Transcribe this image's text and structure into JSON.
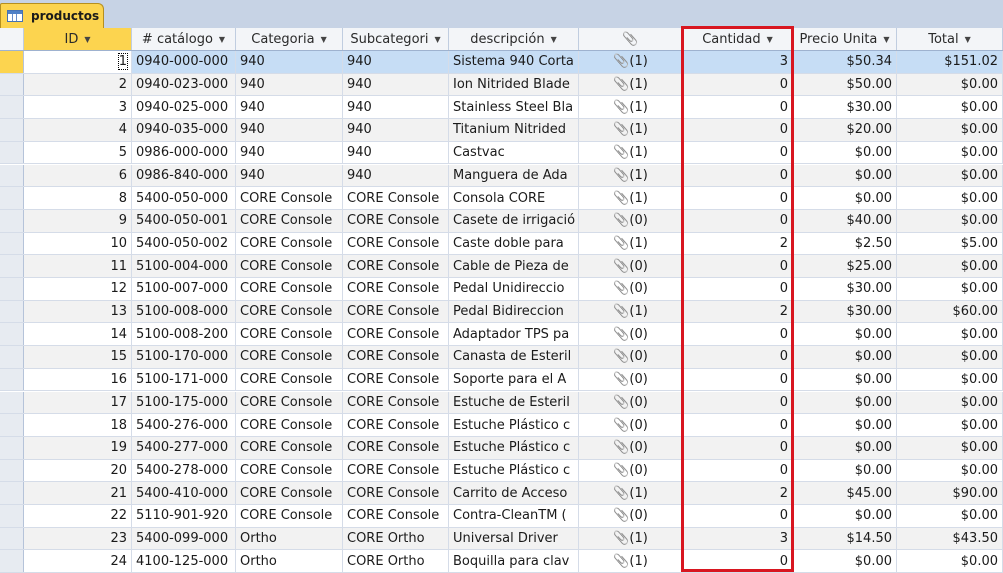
{
  "tab": {
    "label": "productos",
    "icon": "table-icon"
  },
  "columns": [
    {
      "label": "ID"
    },
    {
      "label": "# catálogo"
    },
    {
      "label": "Categoria"
    },
    {
      "label": "Subcategori"
    },
    {
      "label": "descripción"
    },
    {
      "label": "",
      "icon": "paperclip-icon"
    },
    {
      "label": "Cantidad"
    },
    {
      "label": "Precio Unita"
    },
    {
      "label": "Total"
    }
  ],
  "rows": [
    {
      "id": "1",
      "cat": "0940-000-000",
      "categoria": "940",
      "sub": "940",
      "desc": "Sistema 940 Corta",
      "att": "(1)",
      "cant": "3",
      "precio": "$50.34",
      "total": "$151.02"
    },
    {
      "id": "2",
      "cat": "0940-023-000",
      "categoria": "940",
      "sub": "940",
      "desc": "Ion Nitrided Blade",
      "att": "(1)",
      "cant": "0",
      "precio": "$50.00",
      "total": "$0.00"
    },
    {
      "id": "3",
      "cat": "0940-025-000",
      "categoria": "940",
      "sub": "940",
      "desc": "Stainless Steel Bla",
      "att": "(1)",
      "cant": "0",
      "precio": "$30.00",
      "total": "$0.00"
    },
    {
      "id": "4",
      "cat": "0940-035-000",
      "categoria": "940",
      "sub": "940",
      "desc": "Titanium Nitrided",
      "att": "(1)",
      "cant": "0",
      "precio": "$20.00",
      "total": "$0.00"
    },
    {
      "id": "5",
      "cat": "0986-000-000",
      "categoria": "940",
      "sub": "940",
      "desc": "Castvac",
      "att": "(1)",
      "cant": "0",
      "precio": "$0.00",
      "total": "$0.00"
    },
    {
      "id": "6",
      "cat": "0986-840-000",
      "categoria": "940",
      "sub": "940",
      "desc": "Manguera de Ada",
      "att": "(1)",
      "cant": "0",
      "precio": "$0.00",
      "total": "$0.00"
    },
    {
      "id": "8",
      "cat": "5400-050-000",
      "categoria": "CORE Console",
      "sub": "CORE Console",
      "desc": "Consola CORE",
      "att": "(1)",
      "cant": "0",
      "precio": "$0.00",
      "total": "$0.00"
    },
    {
      "id": "9",
      "cat": "5400-050-001",
      "categoria": "CORE Console",
      "sub": "CORE Console",
      "desc": "Casete de irrigació",
      "att": "(0)",
      "cant": "0",
      "precio": "$40.00",
      "total": "$0.00"
    },
    {
      "id": "10",
      "cat": "5400-050-002",
      "categoria": "CORE Console",
      "sub": "CORE Console",
      "desc": "Caste doble para",
      "att": "(1)",
      "cant": "2",
      "precio": "$2.50",
      "total": "$5.00"
    },
    {
      "id": "11",
      "cat": "5100-004-000",
      "categoria": "CORE Console",
      "sub": "CORE Console",
      "desc": "Cable de Pieza de",
      "att": "(0)",
      "cant": "0",
      "precio": "$25.00",
      "total": "$0.00"
    },
    {
      "id": "12",
      "cat": "5100-007-000",
      "categoria": "CORE Console",
      "sub": "CORE Console",
      "desc": "Pedal Unidireccio",
      "att": "(0)",
      "cant": "0",
      "precio": "$30.00",
      "total": "$0.00"
    },
    {
      "id": "13",
      "cat": "5100-008-000",
      "categoria": "CORE Console",
      "sub": "CORE Console",
      "desc": "Pedal Bidireccion",
      "att": "(1)",
      "cant": "2",
      "precio": "$30.00",
      "total": "$60.00"
    },
    {
      "id": "14",
      "cat": "5100-008-200",
      "categoria": "CORE Console",
      "sub": "CORE Console",
      "desc": "Adaptador TPS pa",
      "att": "(0)",
      "cant": "0",
      "precio": "$0.00",
      "total": "$0.00"
    },
    {
      "id": "15",
      "cat": "5100-170-000",
      "categoria": "CORE Console",
      "sub": "CORE Console",
      "desc": "Canasta de Esteril",
      "att": "(0)",
      "cant": "0",
      "precio": "$0.00",
      "total": "$0.00"
    },
    {
      "id": "16",
      "cat": "5100-171-000",
      "categoria": "CORE Console",
      "sub": "CORE Console",
      "desc": "Soporte para el A",
      "att": "(0)",
      "cant": "0",
      "precio": "$0.00",
      "total": "$0.00"
    },
    {
      "id": "17",
      "cat": "5100-175-000",
      "categoria": "CORE Console",
      "sub": "CORE Console",
      "desc": "Estuche de Esteril",
      "att": "(0)",
      "cant": "0",
      "precio": "$0.00",
      "total": "$0.00"
    },
    {
      "id": "18",
      "cat": "5400-276-000",
      "categoria": "CORE Console",
      "sub": "CORE Console",
      "desc": "Estuche Plástico c",
      "att": "(0)",
      "cant": "0",
      "precio": "$0.00",
      "total": "$0.00"
    },
    {
      "id": "19",
      "cat": "5400-277-000",
      "categoria": "CORE Console",
      "sub": "CORE Console",
      "desc": "Estuche Plástico c",
      "att": "(0)",
      "cant": "0",
      "precio": "$0.00",
      "total": "$0.00"
    },
    {
      "id": "20",
      "cat": "5400-278-000",
      "categoria": "CORE Console",
      "sub": "CORE Console",
      "desc": "Estuche Plástico c",
      "att": "(0)",
      "cant": "0",
      "precio": "$0.00",
      "total": "$0.00"
    },
    {
      "id": "21",
      "cat": "5400-410-000",
      "categoria": "CORE Console",
      "sub": "CORE Console",
      "desc": "Carrito de Acceso",
      "att": "(1)",
      "cant": "2",
      "precio": "$45.00",
      "total": "$90.00"
    },
    {
      "id": "22",
      "cat": "5110-901-920",
      "categoria": "CORE Console",
      "sub": "CORE Console",
      "desc": "Contra-CleanTM (",
      "att": "(0)",
      "cant": "0",
      "precio": "$0.00",
      "total": "$0.00"
    },
    {
      "id": "23",
      "cat": "5400-099-000",
      "categoria": "Ortho",
      "sub": "CORE Ortho",
      "desc": "Universal Driver",
      "att": "(1)",
      "cant": "3",
      "precio": "$14.50",
      "total": "$43.50"
    },
    {
      "id": "24",
      "cat": "4100-125-000",
      "categoria": "Ortho",
      "sub": "CORE Ortho",
      "desc": "Boquilla para clav",
      "att": "(1)",
      "cant": "0",
      "precio": "$0.00",
      "total": "$0.00"
    }
  ],
  "colors": {
    "highlight_box": "#d81620",
    "tab": "#fcd44f",
    "selected_row": "#c6ddf5"
  }
}
